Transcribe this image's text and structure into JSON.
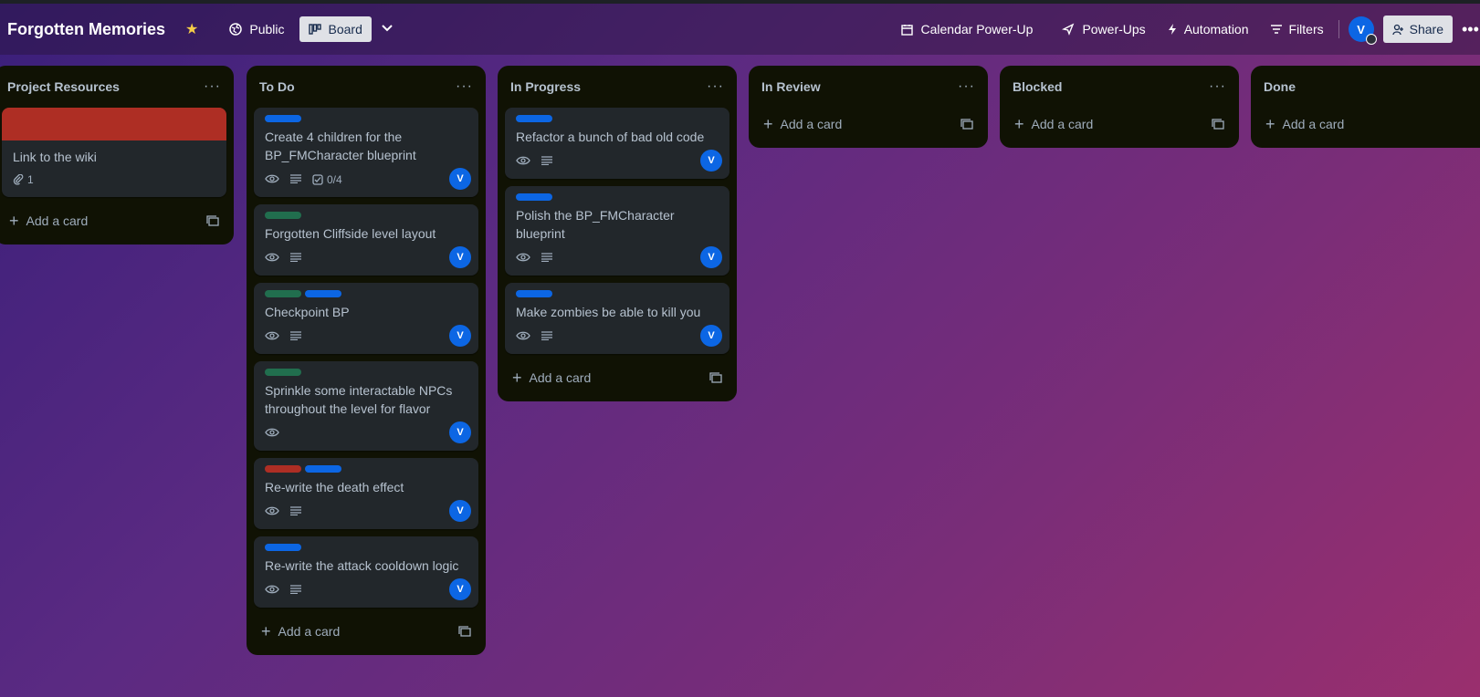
{
  "header": {
    "board_title": "Forgotten Memories",
    "visibility": "Public",
    "view": "Board",
    "calendar": "Calendar Power-Up",
    "powerups": "Power-Ups",
    "automation": "Automation",
    "filters": "Filters",
    "avatar": "V",
    "share": "Share"
  },
  "colors": {
    "green": "#216e4e",
    "blue": "#0c66e4",
    "red": "#ae2e24"
  },
  "lists": [
    {
      "title": "Project Resources",
      "add": "Add a card",
      "cards": [
        {
          "title": "Link to the wiki",
          "attachments": "1"
        }
      ]
    },
    {
      "title": "To Do",
      "add": "Add a card",
      "cards": [
        {
          "title": "Create 4 children for the BP_FMCharacter blueprint",
          "checklist": "0/4",
          "member": "V"
        },
        {
          "title": "Forgotten Cliffside level layout",
          "member": "V"
        },
        {
          "title": "Checkpoint BP",
          "member": "V"
        },
        {
          "title": "Sprinkle some interactable NPCs throughout the level for flavor",
          "member": "V"
        },
        {
          "title": "Re-write the death effect",
          "member": "V"
        },
        {
          "title": "Re-write the attack cooldown logic",
          "member": "V"
        }
      ]
    },
    {
      "title": "In Progress",
      "add": "Add a card",
      "cards": [
        {
          "title": "Refactor a bunch of bad old code",
          "member": "V"
        },
        {
          "title": "Polish the BP_FMCharacter blueprint",
          "member": "V"
        },
        {
          "title": "Make zombies be able to kill you",
          "member": "V"
        }
      ]
    },
    {
      "title": "In Review",
      "add": "Add a card"
    },
    {
      "title": "Blocked",
      "add": "Add a card"
    },
    {
      "title": "Done",
      "add": "Add a card"
    }
  ]
}
